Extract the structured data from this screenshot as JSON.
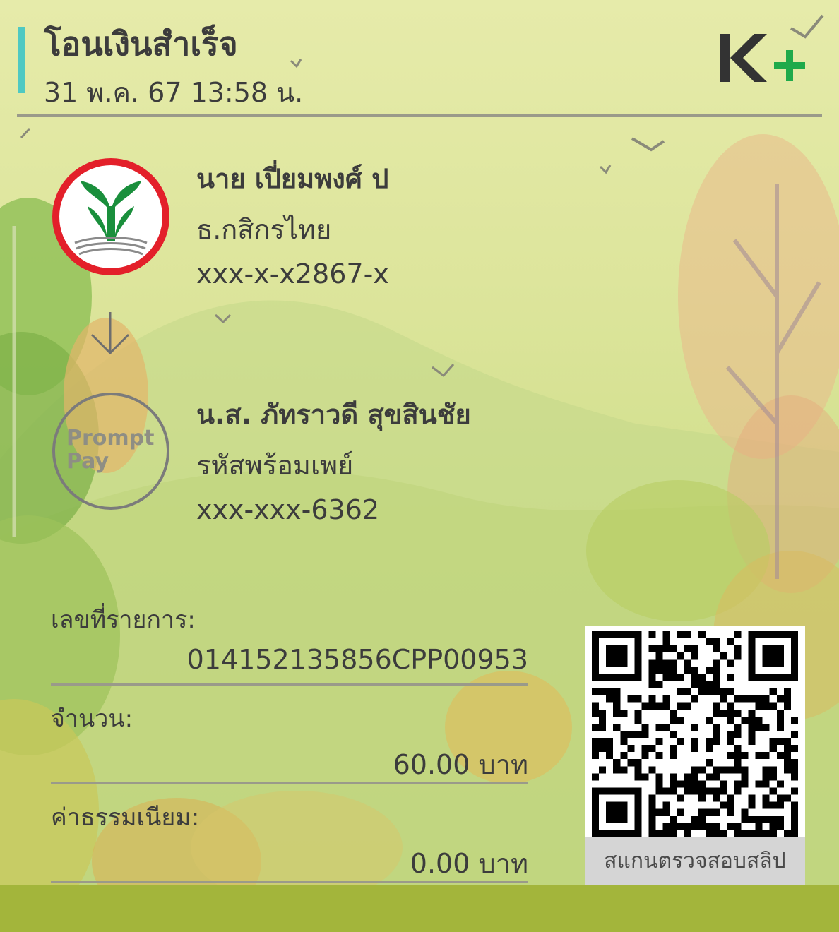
{
  "header": {
    "title": "โอนเงินสำเร็จ",
    "datetime": "31 พ.ค. 67  13:58 น.",
    "brand_logo": "K+"
  },
  "sender": {
    "name": "นาย เปี่ยมพงศ์ ป",
    "bank": "ธ.กสิกรไทย",
    "account": "xxx-x-x2867-x",
    "logo_icon": "kasikorn-bank-logo"
  },
  "receiver": {
    "name": "น.ส. ภัทราวดี สุขสินชัย",
    "channel": "รหัสพร้อมเพย์",
    "account": "xxx-xxx-6362",
    "logo_text_line1": "Prompt",
    "logo_text_line2": "Pay"
  },
  "details": {
    "ref_label": "เลขที่รายการ:",
    "ref_value": "014152135856CPP00953",
    "amount_label": "จำนวน:",
    "amount_value": "60.00 บาท",
    "fee_label": "ค่าธรรมเนียม:",
    "fee_value": "0.00 บาท"
  },
  "qr": {
    "caption": "สแกนตรวจสอบสลิป"
  },
  "colors": {
    "accent": "#4fc9c2",
    "kbank_green": "#1a8f3c",
    "kbank_red": "#e3202a",
    "text": "#3c3c3c",
    "bottom_bar": "#a3b53b"
  }
}
